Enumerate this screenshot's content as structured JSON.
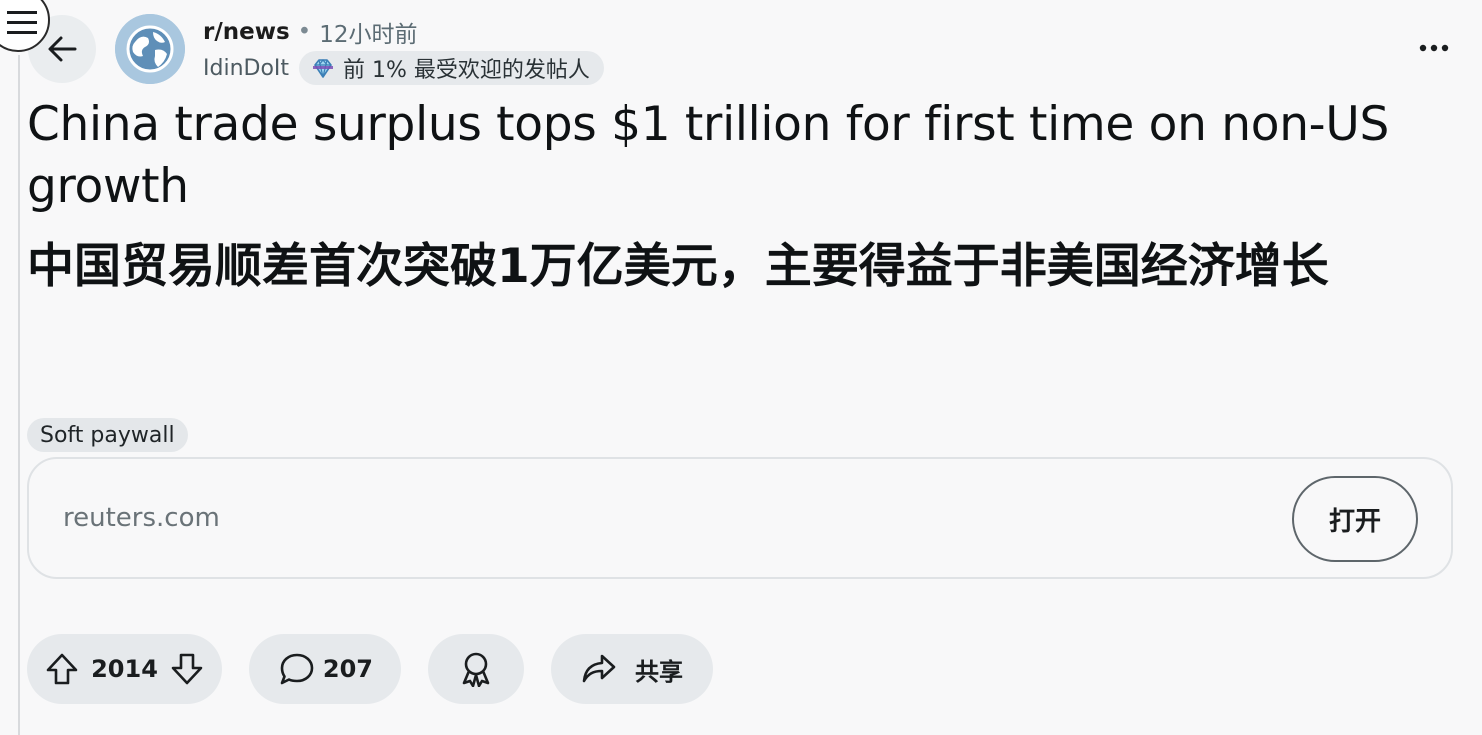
{
  "header": {
    "subreddit": "r/news",
    "separator": "•",
    "age": "12小时前",
    "username": "IdinDoIt",
    "flair_text": "前 1% 最受欢迎的发帖人"
  },
  "post": {
    "title_en": "China trade surplus tops $1 trillion for first time on non-US growth",
    "title_zh": "中国贸易顺差首次突破1万亿美元，主要得益于非美国经济增长",
    "tag": "Soft paywall"
  },
  "link_card": {
    "domain": "reuters.com",
    "open_label": "打开"
  },
  "actions": {
    "votes": "2014",
    "comments": "207",
    "share_label": "共享"
  },
  "icons": {
    "menu": "hamburger-menu-icon",
    "back": "arrow-left-icon",
    "avatar": "globe-icon",
    "flair": "gem-icon",
    "more": "more-horizontal-icon",
    "upvote": "arrow-up-icon",
    "downvote": "arrow-down-icon",
    "comment": "speech-bubble-icon",
    "award": "award-ribbon-icon",
    "share": "share-arrow-icon"
  }
}
